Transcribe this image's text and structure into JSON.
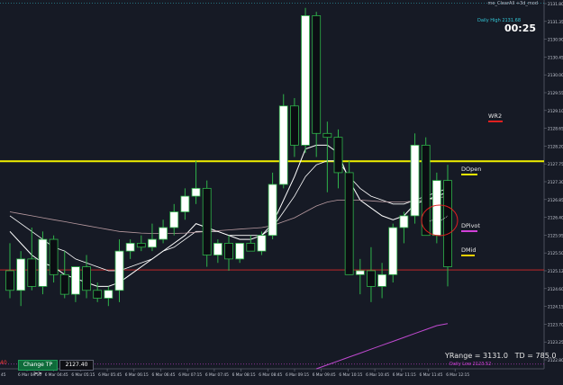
{
  "window": {
    "title": "me_ClearAll +3d_mod",
    "countdown": "00:25",
    "daily_high": "Daily High 2131.68",
    "daily_low": "Daily Low 2123.52",
    "yrange_text": "YRange = 3131.0",
    "td_text": "TD = 785.0"
  },
  "levels": {
    "wr2": "WR2",
    "dopen": "DOpen",
    "dpivot": "DPivot",
    "dmid": "DMid"
  },
  "controls": {
    "change_tp_label": "Change TP >>",
    "tp_value": "2127.40",
    "left_tag": "40"
  },
  "colors": {
    "background": "#161a25",
    "bull_candle": "#ffffff",
    "bear_candle": "#0b0d12",
    "dopen_line": "#f0f000",
    "price_line": "#d82a2a",
    "wr2": "#e02020",
    "dpivot": "#d040d8",
    "dmid": "#f0d000",
    "daily_high": "#33c6d6",
    "daily_low": "#d040d8"
  },
  "chart_data": {
    "type": "candlestick",
    "y_axis_labels": [
      "2131.80",
      "2131.35",
      "2130.90",
      "2130.45",
      "2130.00",
      "2129.55",
      "2129.10",
      "2128.65",
      "2128.20",
      "2127.75",
      "2127.30",
      "2126.85",
      "2126.40",
      "2125.95",
      "2125.50",
      "2125.12",
      "2124.60",
      "2124.15",
      "2123.70",
      "2123.25",
      "2122.80"
    ],
    "x_axis_labels": [
      "6 Mar 04:15",
      "6 Mar 04:45",
      "6 Mar 05:15",
      "6 Mar 05:45",
      "6 Mar 06:15",
      "6 Mar 06:45",
      "6 Mar 07:15",
      "6 Mar 07:45",
      "6 Mar 08:15",
      "6 Mar 08:45",
      "6 Mar 09:15",
      "6 Mar 09:45",
      "6 Mar 10:15",
      "6 Mar 10:45",
      "6 Mar 11:15",
      "6 Mar 11:45",
      "6 Mar 12:15"
    ],
    "x_axis_left_stub": "45",
    "ylim": [
      2122.6,
      2132.0
    ],
    "current_price": 2125.12,
    "dopen": 2127.89,
    "candles": [
      {
        "o": 2125.1,
        "h": 2125.8,
        "l": 2124.4,
        "c": 2124.6
      },
      {
        "o": 2124.6,
        "h": 2125.6,
        "l": 2124.2,
        "c": 2125.4
      },
      {
        "o": 2125.4,
        "h": 2126.2,
        "l": 2124.6,
        "c": 2124.7
      },
      {
        "o": 2124.7,
        "h": 2126.1,
        "l": 2124.5,
        "c": 2125.9
      },
      {
        "o": 2125.9,
        "h": 2126.0,
        "l": 2124.8,
        "c": 2125.0
      },
      {
        "o": 2125.0,
        "h": 2125.6,
        "l": 2124.4,
        "c": 2124.5
      },
      {
        "o": 2124.5,
        "h": 2125.2,
        "l": 2124.3,
        "c": 2125.2
      },
      {
        "o": 2125.2,
        "h": 2125.5,
        "l": 2124.4,
        "c": 2124.6
      },
      {
        "o": 2124.6,
        "h": 2124.8,
        "l": 2124.3,
        "c": 2124.4
      },
      {
        "o": 2124.4,
        "h": 2124.7,
        "l": 2124.2,
        "c": 2124.6
      },
      {
        "o": 2124.6,
        "h": 2125.9,
        "l": 2124.3,
        "c": 2125.6
      },
      {
        "o": 2125.6,
        "h": 2125.9,
        "l": 2125.4,
        "c": 2125.8
      },
      {
        "o": 2125.8,
        "h": 2126.0,
        "l": 2125.6,
        "c": 2125.7
      },
      {
        "o": 2125.7,
        "h": 2126.3,
        "l": 2125.6,
        "c": 2125.9
      },
      {
        "o": 2125.9,
        "h": 2126.4,
        "l": 2125.8,
        "c": 2126.2
      },
      {
        "o": 2126.2,
        "h": 2126.8,
        "l": 2126.0,
        "c": 2126.6
      },
      {
        "o": 2126.6,
        "h": 2127.2,
        "l": 2126.4,
        "c": 2127.0
      },
      {
        "o": 2127.0,
        "h": 2127.9,
        "l": 2126.8,
        "c": 2127.2
      },
      {
        "o": 2127.2,
        "h": 2127.4,
        "l": 2125.2,
        "c": 2125.5
      },
      {
        "o": 2125.5,
        "h": 2125.9,
        "l": 2125.3,
        "c": 2125.8
      },
      {
        "o": 2125.8,
        "h": 2126.0,
        "l": 2125.1,
        "c": 2125.4
      },
      {
        "o": 2125.4,
        "h": 2125.8,
        "l": 2125.3,
        "c": 2125.8
      },
      {
        "o": 2125.8,
        "h": 2126.0,
        "l": 2125.6,
        "c": 2125.6
      },
      {
        "o": 2125.6,
        "h": 2126.1,
        "l": 2125.5,
        "c": 2126.0
      },
      {
        "o": 2126.0,
        "h": 2127.6,
        "l": 2125.9,
        "c": 2127.3
      },
      {
        "o": 2127.3,
        "h": 2129.6,
        "l": 2127.2,
        "c": 2129.3
      },
      {
        "o": 2129.3,
        "h": 2129.5,
        "l": 2128.0,
        "c": 2128.3
      },
      {
        "o": 2128.3,
        "h": 2131.8,
        "l": 2128.1,
        "c": 2131.6
      },
      {
        "o": 2131.6,
        "h": 2131.7,
        "l": 2128.0,
        "c": 2128.6
      },
      {
        "o": 2128.6,
        "h": 2128.9,
        "l": 2127.1,
        "c": 2128.5
      },
      {
        "o": 2128.5,
        "h": 2128.7,
        "l": 2127.2,
        "c": 2127.6
      },
      {
        "o": 2127.6,
        "h": 2127.9,
        "l": 2125.0,
        "c": 2125.0
      },
      {
        "o": 2125.0,
        "h": 2125.4,
        "l": 2124.5,
        "c": 2125.1
      },
      {
        "o": 2125.1,
        "h": 2125.7,
        "l": 2124.3,
        "c": 2124.7
      },
      {
        "o": 2124.7,
        "h": 2125.3,
        "l": 2124.4,
        "c": 2125.0
      },
      {
        "o": 2125.0,
        "h": 2126.3,
        "l": 2124.8,
        "c": 2126.2
      },
      {
        "o": 2126.2,
        "h": 2126.6,
        "l": 2125.8,
        "c": 2126.5
      },
      {
        "o": 2126.5,
        "h": 2128.6,
        "l": 2126.3,
        "c": 2128.3
      },
      {
        "o": 2128.3,
        "h": 2128.5,
        "l": 2126.0,
        "c": 2126.0
      },
      {
        "o": 2126.0,
        "h": 2127.6,
        "l": 2125.8,
        "c": 2127.4
      },
      {
        "o": 2127.4,
        "h": 2127.8,
        "l": 2124.7,
        "c": 2125.2
      }
    ],
    "moving_averages": [
      {
        "name": "fast",
        "values": [
          2126.1,
          2125.8,
          2125.5,
          2125.3,
          2125.2,
          2125.0,
          2124.9,
          2124.8,
          2124.7,
          2124.7,
          2124.8,
          2125.0,
          2125.2,
          2125.4,
          2125.6,
          2125.8,
          2126.0,
          2126.3,
          2126.2,
          2126.1,
          2126.0,
          2125.9,
          2125.9,
          2126.0,
          2126.3,
          2126.9,
          2127.5,
          2128.2,
          2128.3,
          2128.3,
          2128.1,
          2127.4,
          2126.9,
          2126.7,
          2126.5,
          2126.4,
          2126.5,
          2126.8,
          2126.9,
          2127.0,
          2127.1
        ]
      },
      {
        "name": "slow",
        "values": [
          2126.5,
          2126.3,
          2126.1,
          2125.9,
          2125.7,
          2125.6,
          2125.4,
          2125.3,
          2125.2,
          2125.1,
          2125.1,
          2125.2,
          2125.3,
          2125.4,
          2125.6,
          2125.7,
          2125.9,
          2126.1,
          2126.1,
          2126.1,
          2126.0,
          2126.0,
          2126.0,
          2126.0,
          2126.2,
          2126.6,
          2127.0,
          2127.5,
          2127.8,
          2127.9,
          2127.9,
          2127.5,
          2127.2,
          2127.0,
          2126.9,
          2126.8,
          2126.8,
          2126.9,
          2127.0,
          2127.1,
          2127.2
        ]
      },
      {
        "name": "long",
        "values": [
          2126.6,
          2126.55,
          2126.5,
          2126.45,
          2126.4,
          2126.35,
          2126.3,
          2126.25,
          2126.2,
          2126.15,
          2126.1,
          2126.08,
          2126.06,
          2126.05,
          2126.05,
          2126.05,
          2126.06,
          2126.08,
          2126.1,
          2126.12,
          2126.14,
          2126.16,
          2126.18,
          2126.2,
          2126.25,
          2126.35,
          2126.45,
          2126.6,
          2126.75,
          2126.85,
          2126.9,
          2126.9,
          2126.9,
          2126.88,
          2126.86,
          2126.85,
          2126.85,
          2126.88,
          2126.9,
          2126.95,
          2127.0
        ]
      },
      {
        "name": "lower",
        "values": [
          null,
          null,
          null,
          null,
          null,
          null,
          null,
          null,
          null,
          null,
          null,
          null,
          null,
          null,
          null,
          null,
          null,
          null,
          null,
          null,
          null,
          null,
          null,
          null,
          null,
          null,
          null,
          null,
          2122.6,
          2122.7,
          2122.8,
          2122.9,
          2123.0,
          2123.1,
          2123.2,
          2123.3,
          2123.4,
          2123.5,
          2123.6,
          2123.7,
          2123.75
        ]
      }
    ]
  }
}
